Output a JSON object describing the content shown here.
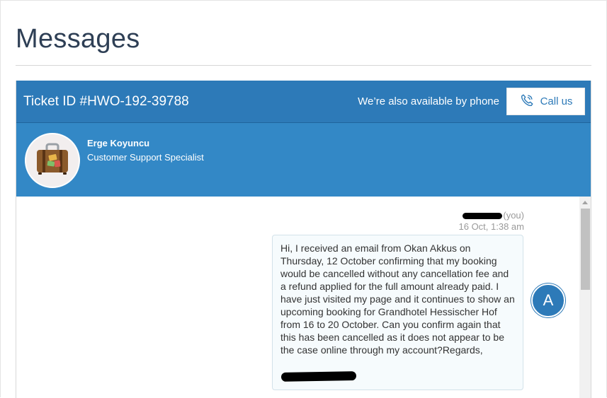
{
  "page": {
    "title": "Messages"
  },
  "ticket": {
    "id_label": "Ticket ID #HWO-192-39788",
    "phone_note": "We’re also available by phone",
    "call_button_label": "Call us"
  },
  "agent": {
    "name": "Erge Koyuncu",
    "role": "Customer Support Specialist",
    "avatar_icon": "suitcase-icon"
  },
  "message": {
    "sender_suffix": "(you)",
    "timestamp": "16 Oct, 1:38 am",
    "body": "Hi, I received an email from Okan Akkus on Thursday, 12 October confirming that my booking would be cancelled without any cancellation fee and a refund applied for the full amount already paid. I have just visited my page and it continues to show an upcoming booking for Grandhotel Hessischer Hof from 16 to 20 October. Can you confirm again that this has been cancelled as it does not appear to be the case online through my account?Regards,",
    "user_initial": "A"
  },
  "colors": {
    "header_blue": "#2d7ab8",
    "agent_bar_blue": "#3388c6",
    "title_text": "#2e3f55",
    "bubble_bg": "#f6fbfd"
  }
}
